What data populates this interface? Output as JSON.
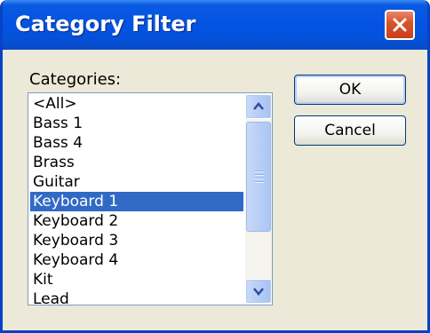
{
  "window": {
    "title": "Category Filter"
  },
  "categories_label": "Categories:",
  "categories": [
    {
      "label": "<All>",
      "selected": false
    },
    {
      "label": "Bass 1",
      "selected": false
    },
    {
      "label": "Bass 4",
      "selected": false
    },
    {
      "label": "Brass",
      "selected": false
    },
    {
      "label": "Guitar",
      "selected": false
    },
    {
      "label": "Keyboard 1",
      "selected": true
    },
    {
      "label": "Keyboard 2",
      "selected": false
    },
    {
      "label": "Keyboard 3",
      "selected": false
    },
    {
      "label": "Keyboard 4",
      "selected": false
    },
    {
      "label": "Kit",
      "selected": false
    },
    {
      "label": "Lead",
      "selected": false
    }
  ],
  "buttons": {
    "ok": "OK",
    "cancel": "Cancel"
  },
  "colors": {
    "titlebar": "#0454e3",
    "selection": "#316ac5",
    "dialog_bg": "#ece9d8",
    "close": "#d9542d"
  },
  "icons": {
    "close": "close-icon",
    "scroll_up": "chevron-up-icon",
    "scroll_down": "chevron-down-icon"
  }
}
